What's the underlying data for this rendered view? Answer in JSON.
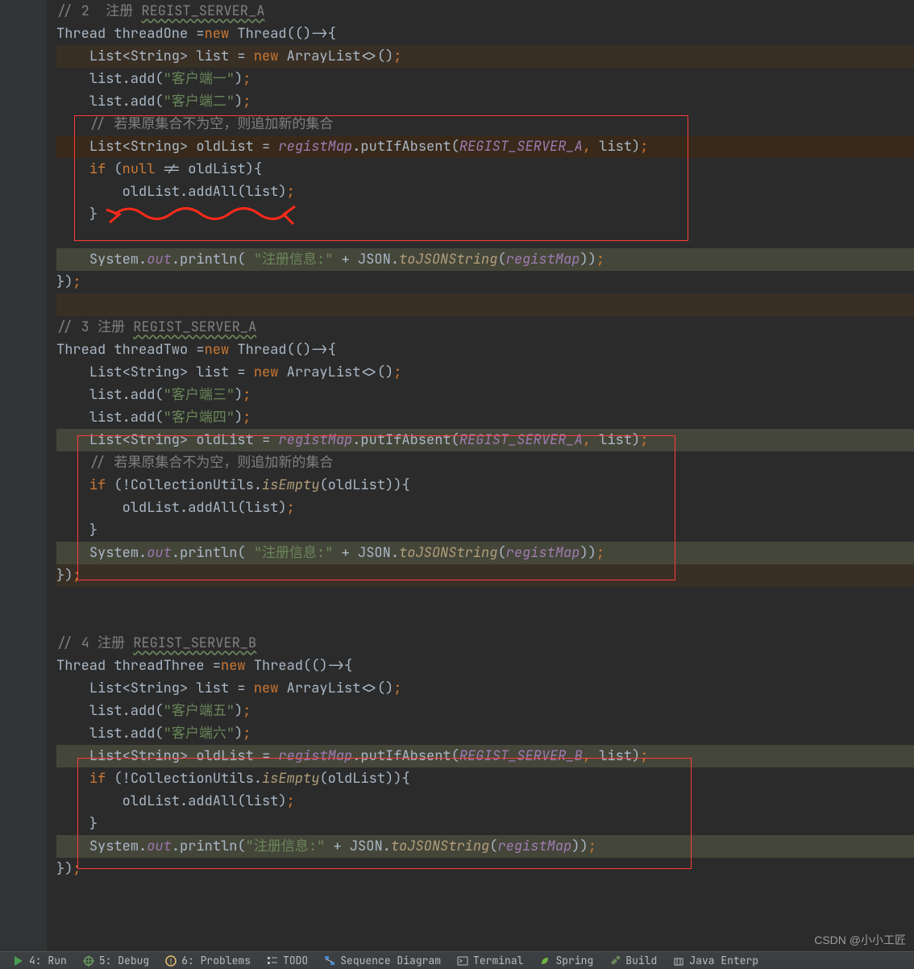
{
  "code": {
    "comment2": "// 2  注册 REGIST_SERVER_A",
    "threadOne": {
      "decl": "Thread threadOne =new Thread(()->{",
      "listDecl": "    List<String> list = new ArrayList<>();",
      "add1": "    list.add(\"客户端一\");",
      "add2": "    list.add(\"客户端二\");",
      "cmt": "    // 若果原集合不为空，则追加新的集合",
      "oldList": "    List<String> oldList = registMap.putIfAbsent(REGIST_SERVER_A, list);",
      "ifLine": "    if (null != oldList){",
      "addAll": "        oldList.addAll(list);",
      "brace": "    }",
      "print": "    System.out.println( \"注册信息:\" + JSON.toJSONString(registMap));",
      "end": "});"
    },
    "comment3": "// 3 注册 REGIST_SERVER_A",
    "threadTwo": {
      "decl": "Thread threadTwo =new Thread(()->{",
      "listDecl": "    List<String> list = new ArrayList<>();",
      "add3": "    list.add(\"客户端三\");",
      "add4": "    list.add(\"客户端四\");",
      "oldList": "    List<String> oldList = registMap.putIfAbsent(REGIST_SERVER_A, list);",
      "cmt": "    // 若果原集合不为空，则追加新的集合",
      "ifLine": "    if (!CollectionUtils.isEmpty(oldList)){",
      "addAll": "        oldList.addAll(list);",
      "brace": "    }",
      "print": "    System.out.println( \"注册信息:\" + JSON.toJSONString(registMap));",
      "end": "});"
    },
    "comment4": "// 4 注册 REGIST_SERVER_B",
    "threadThree": {
      "decl": "Thread threadThree =new Thread(()->{",
      "listDecl": "    List<String> list = new ArrayList<>();",
      "add5": "    list.add(\"客户端五\");",
      "add6": "    list.add(\"客户端六\");",
      "oldList": "    List<String> oldList = registMap.putIfAbsent(REGIST_SERVER_B, list);",
      "ifLine": "    if (!CollectionUtils.isEmpty(oldList)){",
      "addAll": "        oldList.addAll(list);",
      "brace": "    }",
      "print": "    System.out.println(\"注册信息:\" + JSON.toJSONString(registMap));",
      "end": "});"
    }
  },
  "toolbar": {
    "run": "4: Run",
    "debug": "5: Debug",
    "problems": "6: Problems",
    "todo": "TODO",
    "seq": "Sequence Diagram",
    "terminal": "Terminal",
    "spring": "Spring",
    "build": "Build",
    "javaent": "Java Enterp"
  },
  "watermark": "CSDN @小小工匠"
}
